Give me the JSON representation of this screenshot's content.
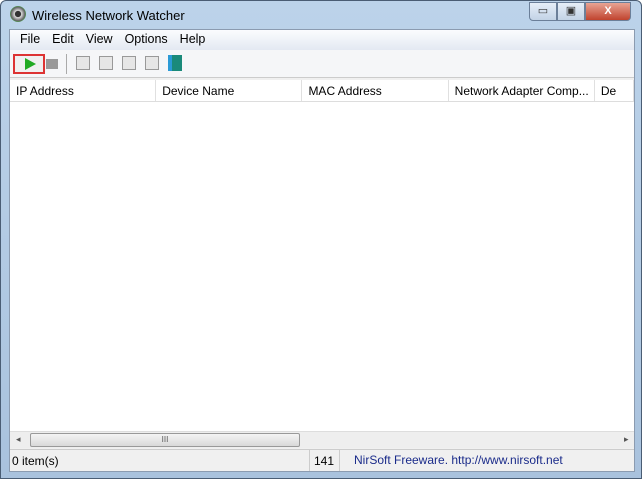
{
  "window": {
    "title": "Wireless Network Watcher",
    "min": "▭",
    "max": "▣",
    "close": "X"
  },
  "menu": [
    "File",
    "Edit",
    "View",
    "Options",
    "Help"
  ],
  "columns": [
    "IP Address",
    "Device Name",
    "MAC Address",
    "Network Adapter Comp...",
    "De"
  ],
  "status": {
    "items": "0 item(s)",
    "count": "141",
    "link": "NirSoft Freeware.  http://www.nirsoft.net"
  },
  "scroll": {
    "grip": "III",
    "left": "◂",
    "right": "▸"
  }
}
